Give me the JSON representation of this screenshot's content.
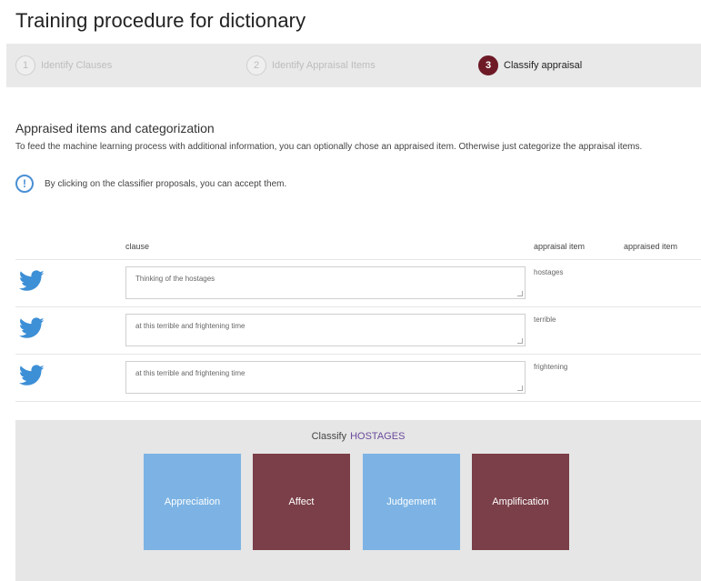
{
  "page": {
    "title": "Training procedure for dictionary"
  },
  "stepper": {
    "steps": [
      {
        "number": "1",
        "label": "Identify Clauses"
      },
      {
        "number": "2",
        "label": "Identify Appraisal Items"
      },
      {
        "number": "3",
        "label": "Classify appraisal"
      }
    ],
    "active_step": 3
  },
  "section": {
    "title": "Appraised items and categorization",
    "description": "To feed the machine learning process with additional information, you can optionally chose an appraised item. Otherwise just categorize the appraisal items.",
    "info": "By clicking on the classifier proposals, you can accept them."
  },
  "table": {
    "headers": {
      "clause": "clause",
      "appraisal_item": "appraisal item",
      "appraised_item": "appraised item"
    },
    "rows": [
      {
        "clause": "Thinking of the hostages",
        "appraisal_item": "hostages",
        "appraised_item": "",
        "icon": "twitter-bird-icon"
      },
      {
        "clause": "at this terrible and frightening time",
        "appraisal_item": "terrible",
        "appraised_item": "",
        "icon": "twitter-bird-icon"
      },
      {
        "clause": "at this terrible and frightening time",
        "appraisal_item": "frightening",
        "appraised_item": "",
        "icon": "twitter-bird-icon"
      }
    ]
  },
  "classify": {
    "prefix": "Classify",
    "target": "HOSTAGES",
    "categories": [
      {
        "label": "Appreciation",
        "color": "#7cb3e4"
      },
      {
        "label": "Affect",
        "color": "#7a3f48"
      },
      {
        "label": "Judgement",
        "color": "#7cb3e4"
      },
      {
        "label": "Amplification",
        "color": "#7a3f48"
      }
    ]
  },
  "colors": {
    "accent": "#6d1a26",
    "twitter_blue": "#3d8fd6",
    "info_blue": "#4a8fd4",
    "highlight_purple": "#6a4a9c"
  }
}
